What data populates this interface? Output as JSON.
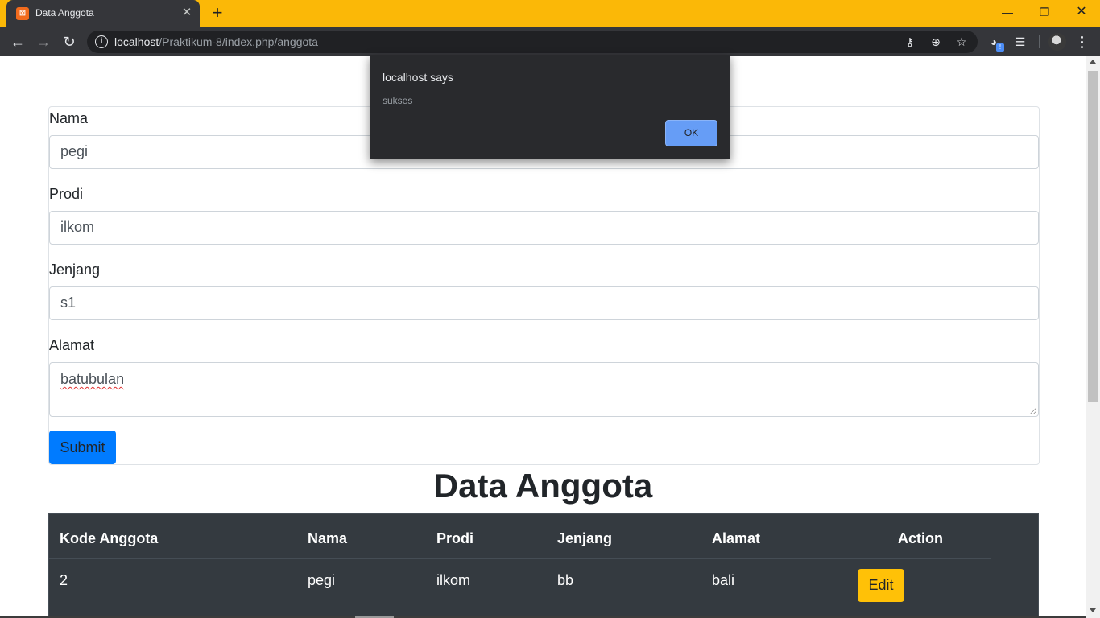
{
  "browser": {
    "tab_title": "Data Anggota",
    "tab_favicon_glyph": "⊠",
    "url_host": "localhost",
    "url_path": "/Praktikum-8/index.php/anggota",
    "icons": [
      "back-arrow-icon",
      "forward-arrow-icon",
      "reload-icon",
      "info-icon",
      "key-icon",
      "zoom-icon",
      "star-icon",
      "extension-icon",
      "reading-list-icon",
      "profile-avatar",
      "kebab-menu-icon"
    ],
    "accent_color": "#fbb807"
  },
  "form": {
    "nama_label": "Nama",
    "nama_value": "pegi",
    "prodi_label": "Prodi",
    "prodi_value": "ilkom",
    "jenjang_label": "Jenjang",
    "jenjang_value": "s1",
    "alamat_label": "Alamat",
    "alamat_value": "batubulan",
    "submit_label": "Submit"
  },
  "table": {
    "heading": "Data Anggota",
    "columns": [
      "Kode Anggota",
      "Nama",
      "Prodi",
      "Jenjang",
      "Alamat",
      "Action"
    ],
    "rows": [
      {
        "kode": "2",
        "nama": "pegi",
        "prodi": "ilkom",
        "jenjang": "bb",
        "alamat": "bali",
        "action_label": "Edit"
      }
    ]
  },
  "dialog": {
    "title": "localhost says",
    "message": "sukses",
    "ok_label": "OK"
  }
}
